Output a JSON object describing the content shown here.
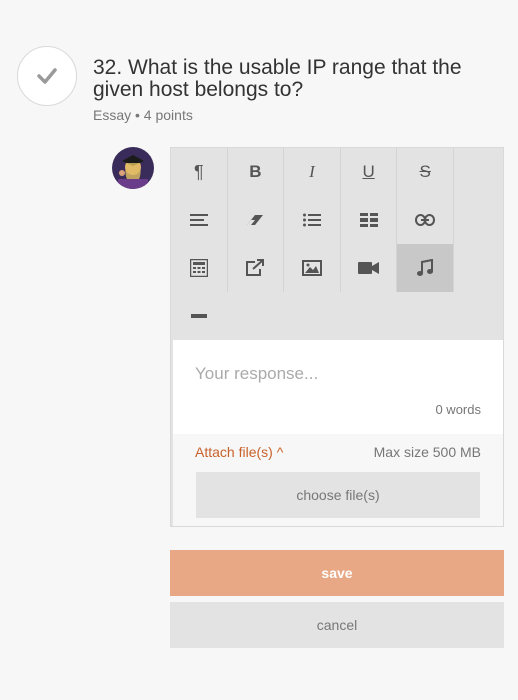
{
  "question": {
    "title": "32. What is the usable IP range that the given host belongs to?",
    "meta": "Essay • 4 points"
  },
  "toolbar": {
    "buttons": [
      {
        "name": "paragraph-icon",
        "glyph": "¶"
      },
      {
        "name": "bold-icon",
        "glyph": "B"
      },
      {
        "name": "italic-icon",
        "glyph": "I"
      },
      {
        "name": "underline-icon",
        "glyph": "U"
      },
      {
        "name": "strikethrough-icon",
        "glyph": "S"
      },
      {
        "name": "align-icon"
      },
      {
        "name": "eraser-icon"
      },
      {
        "name": "bullet-list-icon"
      },
      {
        "name": "table-layout-icon"
      },
      {
        "name": "link-icon"
      },
      {
        "name": "calculator-icon"
      },
      {
        "name": "external-link-icon"
      },
      {
        "name": "image-icon"
      },
      {
        "name": "video-icon"
      },
      {
        "name": "music-icon"
      },
      {
        "name": "horizontal-rule-icon"
      }
    ]
  },
  "response": {
    "placeholder": "Your response...",
    "word_count": "0 words"
  },
  "attach": {
    "label": "Attach file(s) ^",
    "max_size": "Max size 500 MB",
    "choose": "choose file(s)"
  },
  "actions": {
    "save": "save",
    "cancel": "cancel"
  },
  "colors": {
    "accent": "#c9612b",
    "save_bg": "#e8a885"
  }
}
